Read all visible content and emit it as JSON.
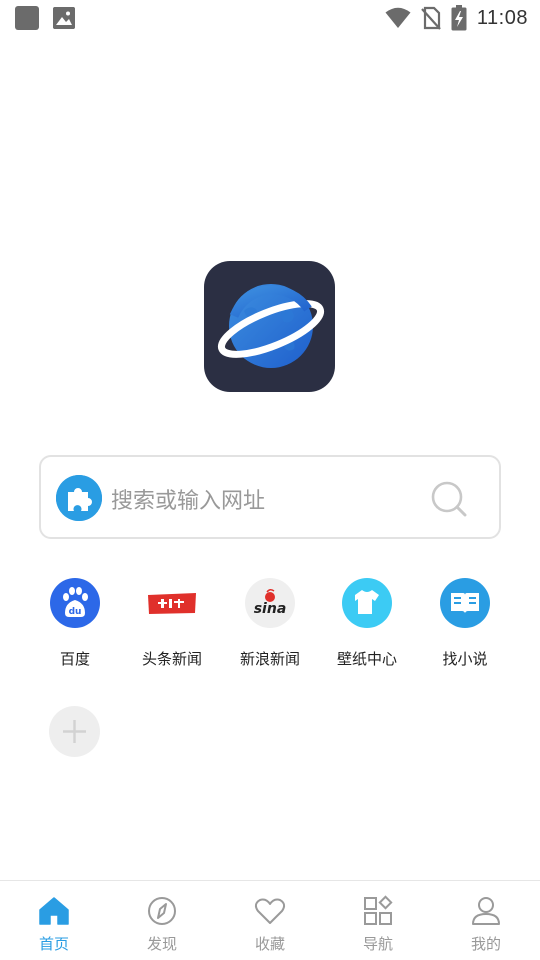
{
  "status_bar": {
    "time": "11:08",
    "icons": [
      "notification-square-icon",
      "image-icon",
      "wifi-icon",
      "no-sim-icon",
      "battery-charging-icon"
    ]
  },
  "app": {
    "logo_icon": "planet-logo-icon",
    "brand_color": "#2a9de3",
    "logo_bg": "#2b2f43"
  },
  "search": {
    "placeholder": "搜索或输入网址",
    "left_icon": "puzzle-icon",
    "right_icon": "search-icon"
  },
  "shortcuts": [
    {
      "label": "百度",
      "icon": "baidu-icon"
    },
    {
      "label": "头条新闻",
      "icon": "toutiao-icon"
    },
    {
      "label": "新浪新闻",
      "icon": "sina-icon"
    },
    {
      "label": "壁纸中心",
      "icon": "tshirt-icon"
    },
    {
      "label": "找小说",
      "icon": "book-icon"
    }
  ],
  "add_shortcut_icon": "plus-icon",
  "bottom_nav": {
    "items": [
      {
        "label": "首页",
        "icon": "home-icon",
        "active": true
      },
      {
        "label": "发现",
        "icon": "compass-icon",
        "active": false
      },
      {
        "label": "收藏",
        "icon": "heart-icon",
        "active": false
      },
      {
        "label": "导航",
        "icon": "grid-icon",
        "active": false
      },
      {
        "label": "我的",
        "icon": "user-icon",
        "active": false
      }
    ]
  }
}
